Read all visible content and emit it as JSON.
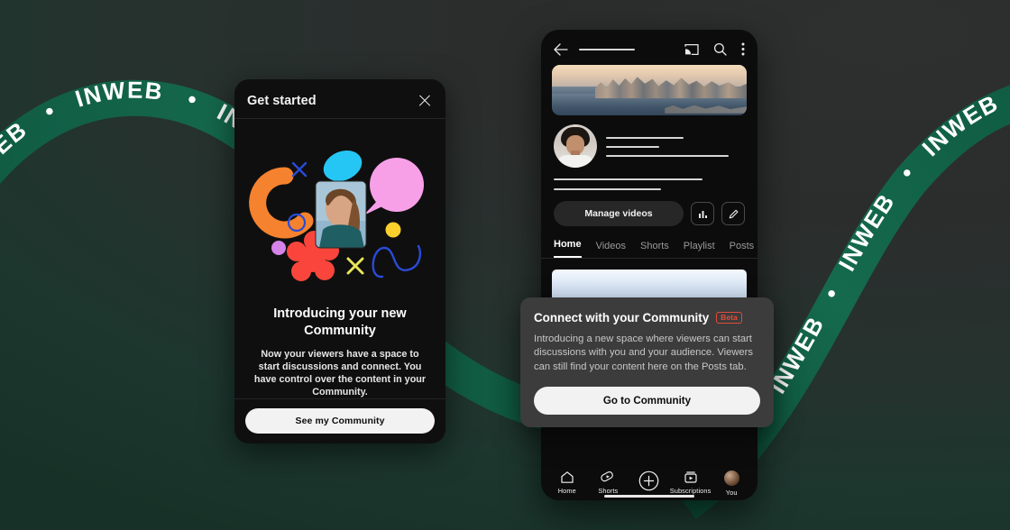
{
  "background": {
    "top_color": "#2b2d2d",
    "bottom_color": "#1c362e",
    "ribbon_color": "#13654a",
    "ribbon_text": "INWEB",
    "ribbon_separator": "•"
  },
  "get_started_sheet": {
    "handle": "drag-handle",
    "title": "Get started",
    "close_icon": "close-icon",
    "illustration": {
      "name": "community-illustration",
      "shapes": [
        {
          "name": "orange-arc",
          "color": "#F5822E"
        },
        {
          "name": "cyan-blob",
          "color": "#26C6F4"
        },
        {
          "name": "pink-speech-bubble",
          "color": "#F7A0E8"
        },
        {
          "name": "red-flower",
          "color": "#F9453B"
        },
        {
          "name": "yellow-dot",
          "color": "#FBD02C"
        },
        {
          "name": "purple-dot",
          "color": "#D583E8"
        },
        {
          "name": "blue-circle-outline",
          "color": "#2A4BD8"
        },
        {
          "name": "blue-x",
          "color": "#2A4BD8"
        },
        {
          "name": "yellow-x",
          "color": "#E8E55A"
        },
        {
          "name": "blue-squiggle",
          "color": "#2A4BD8"
        },
        {
          "name": "creator-photo",
          "color": "#7FA6C4"
        }
      ]
    },
    "heading": "Introducing your new Community",
    "body": "Now your viewers have a space to start discussions and connect. You have control over the content in your Community.",
    "cta_label": "See my Community"
  },
  "phone": {
    "topbar": {
      "back_icon": "back-arrow-icon",
      "title_placeholder": "channel-name-placeholder",
      "cast_icon": "cast-icon",
      "search_icon": "search-icon",
      "more_icon": "more-vertical-icon"
    },
    "banner": {
      "name": "channel-banner",
      "description": "city skyline aerial photo"
    },
    "avatar": {
      "name": "channel-avatar"
    },
    "manage_videos_label": "Manage videos",
    "analytics_icon": "analytics-bar-chart-icon",
    "edit_icon": "pencil-edit-icon",
    "tabs": [
      {
        "label": "Home",
        "active": true
      },
      {
        "label": "Videos",
        "active": false
      },
      {
        "label": "Shorts",
        "active": false
      },
      {
        "label": "Playlist",
        "active": false
      },
      {
        "label": "Posts",
        "active": false
      }
    ],
    "bottom_nav": [
      {
        "label": "Home",
        "icon": "home-icon"
      },
      {
        "label": "Shorts",
        "icon": "shorts-icon"
      },
      {
        "label": "",
        "icon": "create-plus-icon"
      },
      {
        "label": "Subscriptions",
        "icon": "subscriptions-icon"
      },
      {
        "label": "You",
        "icon": "you-avatar-icon"
      }
    ]
  },
  "community_callout": {
    "title": "Connect with your Community",
    "badge": "Beta",
    "body": "Introducing a new space where viewers can start discussions with you and your audience. Viewers can still find your content here on the Posts tab.",
    "cta_label": "Go to Community",
    "badge_color": "#e04b3c",
    "background_color": "#3c3c3c"
  }
}
